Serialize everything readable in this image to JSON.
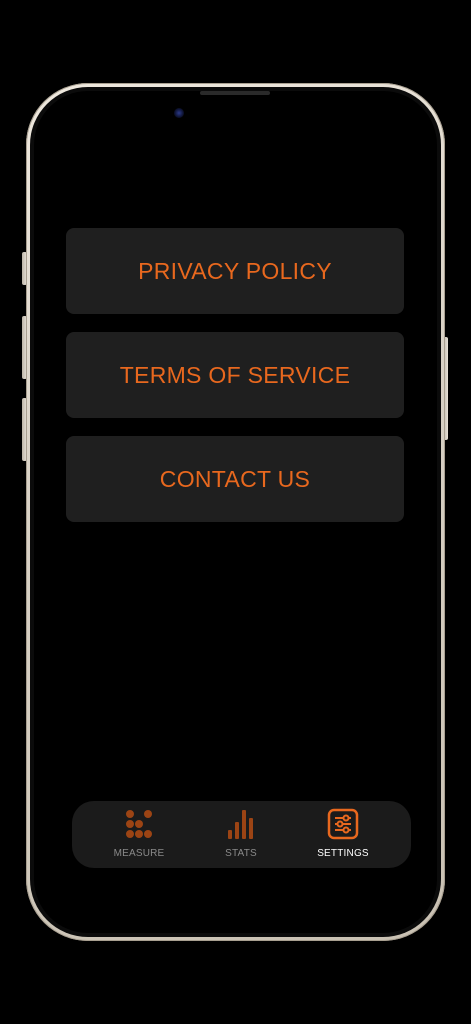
{
  "colors": {
    "accent": "#e8681e",
    "accent_dim": "#9c4414",
    "button_bg": "#1f1f1f",
    "background": "#000000",
    "tab_bar_bg": "#1b1b1b"
  },
  "menu": {
    "items": [
      {
        "label": "PRIVACY POLICY"
      },
      {
        "label": "TERMS OF SERVICE"
      },
      {
        "label": "CONTACT US"
      }
    ]
  },
  "tab_bar": {
    "tabs": [
      {
        "label": "MEASURE",
        "icon": "dots-grid-icon",
        "active": false
      },
      {
        "label": "STATS",
        "icon": "bar-chart-icon",
        "active": false
      },
      {
        "label": "SETTINGS",
        "icon": "sliders-icon",
        "active": true
      }
    ]
  }
}
